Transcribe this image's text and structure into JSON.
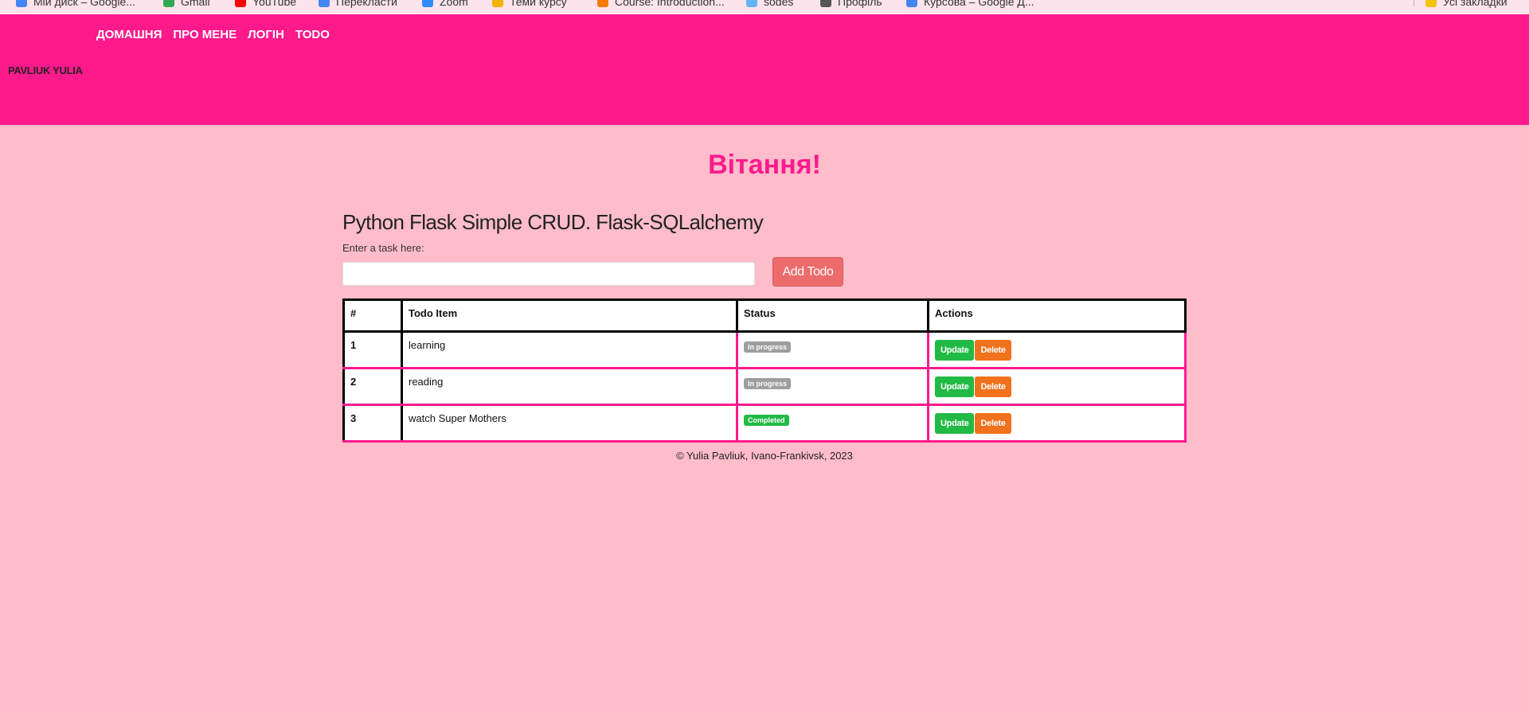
{
  "bookmarks": [
    {
      "label": "Мій диск – Google...",
      "icon_color": "#4285f4"
    },
    {
      "label": "Gmail",
      "icon_color": "#34a853"
    },
    {
      "label": "YouTube",
      "icon_color": "#ff0000"
    },
    {
      "label": "Перекласти",
      "icon_color": "#4285f4"
    },
    {
      "label": "Zoom",
      "icon_color": "#2d8cff"
    },
    {
      "label": "Теми курсу",
      "icon_color": "#f4b400"
    },
    {
      "label": "Course: Introduction...",
      "icon_color": "#f57c00"
    },
    {
      "label": "sodes",
      "icon_color": "#64b5f6"
    },
    {
      "label": "Профіль",
      "icon_color": "#555555"
    },
    {
      "label": "Курсова – Google Д...",
      "icon_color": "#4285f4"
    },
    {
      "label": "Усі закладки",
      "icon_color": "#f4c20d"
    }
  ],
  "header": {
    "nav": [
      "ДОМАШНЯ",
      "ПРО МЕНЕ",
      "ЛОГІН",
      "TODO"
    ],
    "brand": "PAVLIUK YULIA"
  },
  "greeting": "Вітання!",
  "app": {
    "title": "Python Flask Simple CRUD. Flask-SQLalchemy",
    "input_label": "Enter a task here:",
    "input_value": "",
    "add_button": "Add Todo"
  },
  "table": {
    "headers": [
      "#",
      "Todo Item",
      "Status",
      "Actions"
    ],
    "rows": [
      {
        "num": "1",
        "item": "learning",
        "status": "In progress",
        "update": "Update",
        "delete": "Delete"
      },
      {
        "num": "2",
        "item": "reading",
        "status": "In progress",
        "update": "Update",
        "delete": "Delete"
      },
      {
        "num": "3",
        "item": "watch Super Mothers",
        "status": "Completed",
        "update": "Update",
        "delete": "Delete"
      }
    ]
  },
  "footer": "© Yulia Pavliuk, Ivano-Frankivsk, 2023",
  "colors": {
    "page_bg": "#ffbccb",
    "header_bg": "#ff1a8c",
    "accent": "#ff1a8c",
    "add_button": "#ec6b6b",
    "update_button": "#21ba45",
    "delete_button": "#f2711c",
    "badge_progress": "#9e9e9e",
    "badge_completed": "#21ba45"
  }
}
